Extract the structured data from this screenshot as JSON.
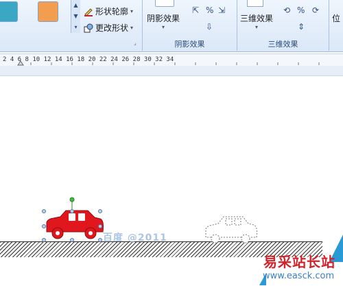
{
  "ribbon": {
    "shape_styles": {
      "outline_label": "形状轮廓",
      "change_shape_label": "更改形状"
    },
    "shadow_group": {
      "button_label": "阴影效果",
      "group_label": "阴影效果"
    },
    "threed_group": {
      "button_label": "三维效果",
      "group_label": "三维效果"
    },
    "cut_label": "位"
  },
  "ruler": {
    "numbers": "2  4  6  8  10  12  14  16  18  20  22  24  26  28  30  32  34"
  },
  "document": {
    "watermark": "百度 @2011",
    "car_color": "#e0171c"
  },
  "logo": {
    "title": "易采站长站",
    "url": "www.easck.com"
  },
  "colors": {
    "swatch_teal": "#3aa7c4",
    "swatch_orange": "#f29d50",
    "accent_blue": "#2a9ad6"
  }
}
